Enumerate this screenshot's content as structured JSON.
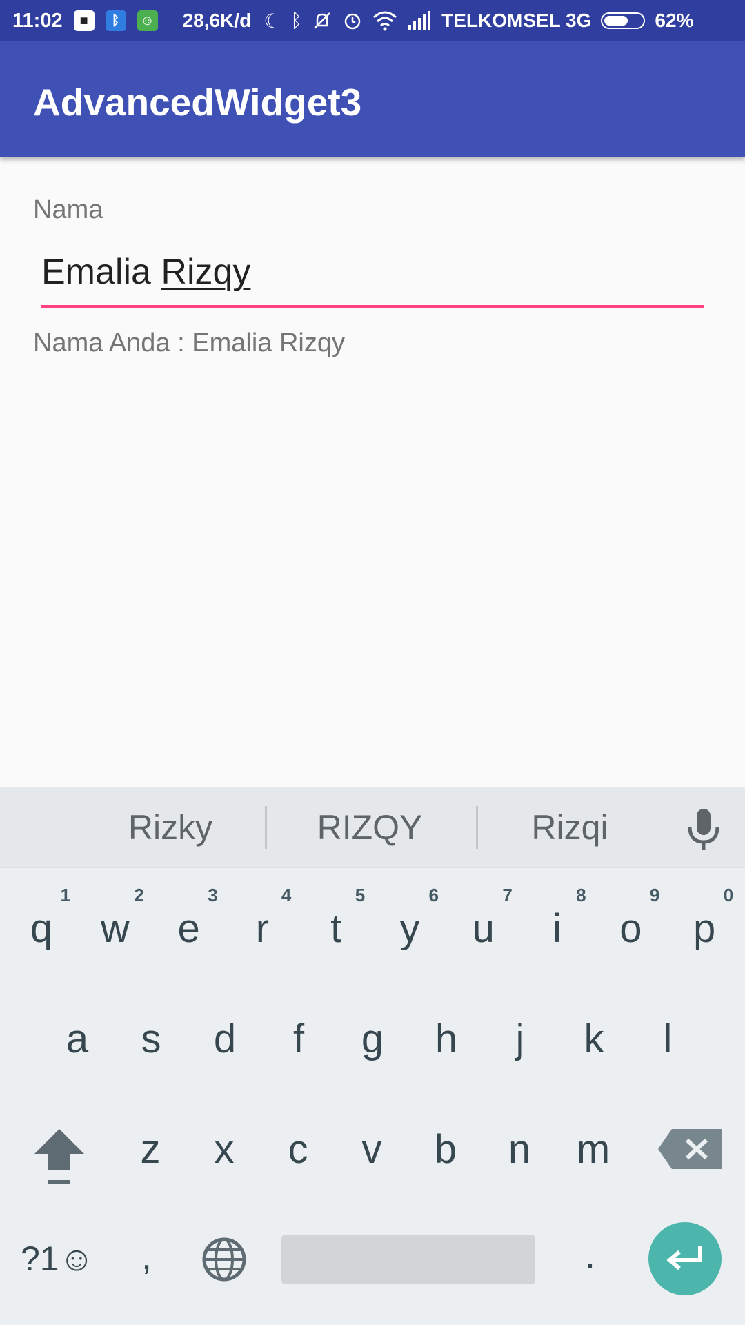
{
  "status_bar": {
    "time": "11:02",
    "speed": "28,6K/d",
    "carrier": "TELKOMSEL 3G",
    "battery_level": "62%",
    "battery_fraction": 0.62,
    "icons": [
      "bbm-icon",
      "bluetooth-app-icon",
      "android-icon",
      "moon-icon",
      "bluetooth-icon",
      "mute-icon",
      "alarm-icon",
      "wifi-icon",
      "signal-icon",
      "battery-icon"
    ]
  },
  "app_bar": {
    "title": "AdvancedWidget3"
  },
  "form": {
    "label": "Nama",
    "input_value_plain": "Emalia ",
    "input_value_composing": "Rizqy",
    "output": "Nama Anda : Emalia Rizqy"
  },
  "keyboard": {
    "suggestions": [
      "Rizky",
      "RIZQY",
      "Rizqi"
    ],
    "row1": [
      {
        "letter": "q",
        "hint": "1"
      },
      {
        "letter": "w",
        "hint": "2"
      },
      {
        "letter": "e",
        "hint": "3"
      },
      {
        "letter": "r",
        "hint": "4"
      },
      {
        "letter": "t",
        "hint": "5"
      },
      {
        "letter": "y",
        "hint": "6"
      },
      {
        "letter": "u",
        "hint": "7"
      },
      {
        "letter": "i",
        "hint": "8"
      },
      {
        "letter": "o",
        "hint": "9"
      },
      {
        "letter": "p",
        "hint": "0"
      }
    ],
    "row2": [
      "a",
      "s",
      "d",
      "f",
      "g",
      "h",
      "j",
      "k",
      "l"
    ],
    "row3": [
      "z",
      "x",
      "c",
      "v",
      "b",
      "n",
      "m"
    ],
    "symbols_label": "?1☺",
    "comma": ",",
    "period": "."
  },
  "colors": {
    "status_bar": "#303f9f",
    "app_bar": "#3f51b5",
    "accent": "#ff4081",
    "enter_key": "#4db6ac"
  }
}
